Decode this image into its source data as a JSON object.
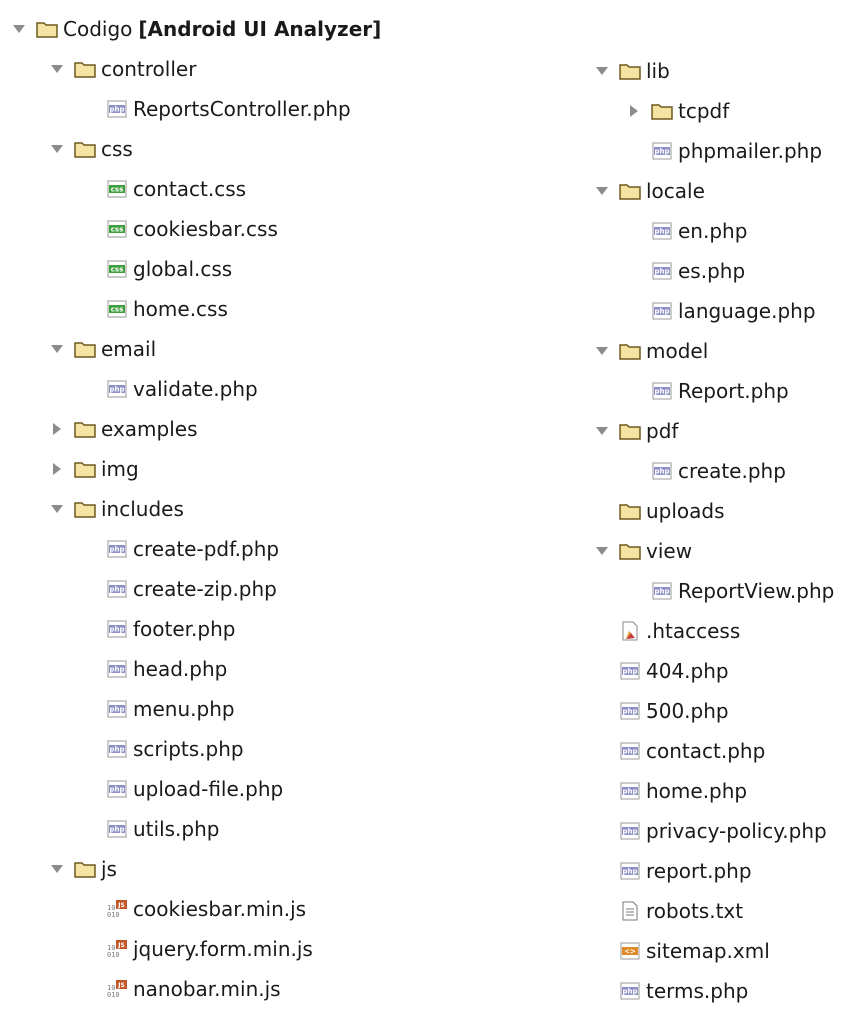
{
  "root": {
    "name": "Codigo",
    "project": "[Android UI Analyzer]"
  },
  "left_items": [
    {
      "label": "controller",
      "type": "folder",
      "depth": 1,
      "expanded": true
    },
    {
      "label": "ReportsController.php",
      "type": "php",
      "depth": 2
    },
    {
      "label": "css",
      "type": "folder",
      "depth": 1,
      "expanded": true
    },
    {
      "label": "contact.css",
      "type": "css",
      "depth": 2
    },
    {
      "label": "cookiesbar.css",
      "type": "css",
      "depth": 2
    },
    {
      "label": "global.css",
      "type": "css",
      "depth": 2
    },
    {
      "label": "home.css",
      "type": "css",
      "depth": 2
    },
    {
      "label": "email",
      "type": "folder",
      "depth": 1,
      "expanded": true
    },
    {
      "label": "validate.php",
      "type": "php",
      "depth": 2
    },
    {
      "label": "examples",
      "type": "folder",
      "depth": 1,
      "expanded": false
    },
    {
      "label": "img",
      "type": "folder",
      "depth": 1,
      "expanded": false
    },
    {
      "label": "includes",
      "type": "folder",
      "depth": 1,
      "expanded": true
    },
    {
      "label": "create-pdf.php",
      "type": "php",
      "depth": 2
    },
    {
      "label": "create-zip.php",
      "type": "php",
      "depth": 2
    },
    {
      "label": "footer.php",
      "type": "php",
      "depth": 2
    },
    {
      "label": "head.php",
      "type": "php",
      "depth": 2
    },
    {
      "label": "menu.php",
      "type": "php",
      "depth": 2
    },
    {
      "label": "scripts.php",
      "type": "php",
      "depth": 2
    },
    {
      "label": "upload-file.php",
      "type": "php",
      "depth": 2
    },
    {
      "label": "utils.php",
      "type": "php",
      "depth": 2
    },
    {
      "label": "js",
      "type": "folder",
      "depth": 1,
      "expanded": true
    },
    {
      "label": "cookiesbar.min.js",
      "type": "js",
      "depth": 2
    },
    {
      "label": "jquery.form.min.js",
      "type": "js",
      "depth": 2
    },
    {
      "label": "nanobar.min.js",
      "type": "js",
      "depth": 2
    }
  ],
  "right_items": [
    {
      "label": "lib",
      "type": "folder",
      "depth": 1,
      "expanded": true
    },
    {
      "label": "tcpdf",
      "type": "folder",
      "depth": 2,
      "expanded": false
    },
    {
      "label": "phpmailer.php",
      "type": "php",
      "depth": 2
    },
    {
      "label": "locale",
      "type": "folder",
      "depth": 1,
      "expanded": true
    },
    {
      "label": "en.php",
      "type": "php",
      "depth": 2
    },
    {
      "label": "es.php",
      "type": "php",
      "depth": 2
    },
    {
      "label": "language.php",
      "type": "php",
      "depth": 2
    },
    {
      "label": "model",
      "type": "folder",
      "depth": 1,
      "expanded": true
    },
    {
      "label": "Report.php",
      "type": "php",
      "depth": 2
    },
    {
      "label": "pdf",
      "type": "folder",
      "depth": 1,
      "expanded": true
    },
    {
      "label": "create.php",
      "type": "php",
      "depth": 2
    },
    {
      "label": "uploads",
      "type": "folder",
      "depth": 1,
      "expanded": null
    },
    {
      "label": "view",
      "type": "folder",
      "depth": 1,
      "expanded": true
    },
    {
      "label": "ReportView.php",
      "type": "php",
      "depth": 2
    },
    {
      "label": ".htaccess",
      "type": "htaccess",
      "depth": 1
    },
    {
      "label": "404.php",
      "type": "php",
      "depth": 1
    },
    {
      "label": "500.php",
      "type": "php",
      "depth": 1
    },
    {
      "label": "contact.php",
      "type": "php",
      "depth": 1
    },
    {
      "label": "home.php",
      "type": "php",
      "depth": 1
    },
    {
      "label": "privacy-policy.php",
      "type": "php",
      "depth": 1
    },
    {
      "label": "report.php",
      "type": "php",
      "depth": 1
    },
    {
      "label": "robots.txt",
      "type": "txt",
      "depth": 1
    },
    {
      "label": "sitemap.xml",
      "type": "xml",
      "depth": 1
    },
    {
      "label": "terms.php",
      "type": "php",
      "depth": 1
    }
  ],
  "colors": {
    "folder": "#e2c86a",
    "folder_stroke": "#6b5a1e",
    "php": "#8d8fc7",
    "css": "#3f9f3f",
    "js": "#c0582b",
    "xml": "#e08a2a",
    "arrow": "#8c8c8c"
  },
  "icons": {
    "folder": "folder-icon",
    "php": "php-file-icon",
    "css": "css-file-icon",
    "js": "js-file-icon",
    "htaccess": "htaccess-file-icon",
    "txt": "text-file-icon",
    "xml": "xml-file-icon"
  }
}
